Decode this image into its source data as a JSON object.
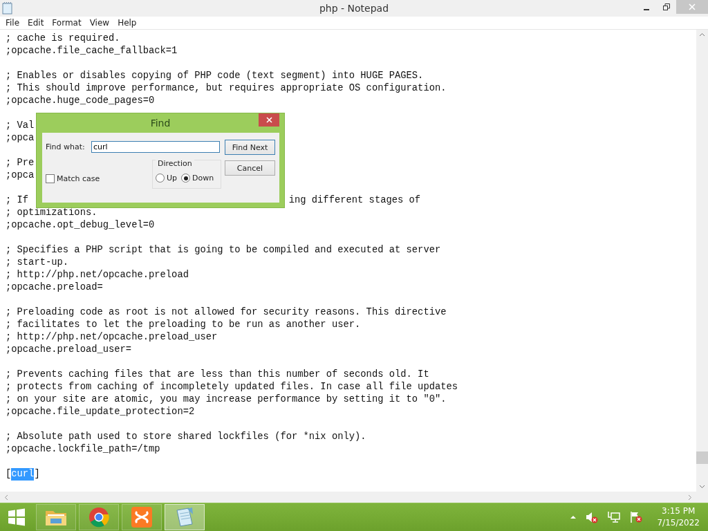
{
  "window": {
    "title": "php - Notepad"
  },
  "menu": [
    "File",
    "Edit",
    "Format",
    "View",
    "Help"
  ],
  "editor": {
    "paragraphs": [
      [
        {
          "text": "; cache is required."
        },
        {
          "text": ";opcache.file_cache_fallback=1"
        }
      ],
      [
        {
          "text": "; Enables or disables copying of PHP code (text segment) into HUGE PAGES."
        },
        {
          "text": "; This should improve performance, but requires appropriate OS configuration."
        },
        {
          "text": ";opcache.huge_code_pages=0"
        }
      ],
      [
        {
          "text": "; Val"
        },
        {
          "text": ";opca"
        }
      ],
      [
        {
          "text": "; Pre"
        },
        {
          "text": ";opca"
        }
      ],
      [
        {
          "text": "; If",
          "tail": "ing different stages of"
        },
        {
          "text": "; optimizations."
        },
        {
          "text": ";opcache.opt_debug_level=0"
        }
      ],
      [
        {
          "text": "; Specifies a PHP script that is going to be compiled and executed at server"
        },
        {
          "text": "; start-up."
        },
        {
          "text": "; http://php.net/opcache.preload"
        },
        {
          "text": ";opcache.preload="
        }
      ],
      [
        {
          "text": "; Preloading code as root is not allowed for security reasons. This directive"
        },
        {
          "text": "; facilitates to let the preloading to be run as another user."
        },
        {
          "text": "; http://php.net/opcache.preload_user"
        },
        {
          "text": ";opcache.preload_user="
        }
      ],
      [
        {
          "text": "; Prevents caching files that are less than this number of seconds old. It"
        },
        {
          "text": "; protects from caching of incompletely updated files. In case all file updates"
        },
        {
          "text": "; on your site are atomic, you may increase performance by setting it to \"0\"."
        },
        {
          "text": ";opcache.file_update_protection=2"
        }
      ],
      [
        {
          "text": "; Absolute path used to store shared lockfiles (for *nix only)."
        },
        {
          "text": ";opcache.lockfile_path=/tmp"
        }
      ],
      [
        {
          "segments": [
            {
              "text": "[",
              "selected": false
            },
            {
              "text": "curl",
              "selected": true
            },
            {
              "text": "]",
              "selected": false
            }
          ]
        }
      ]
    ]
  },
  "find_dialog": {
    "title": "Find",
    "find_what_label": "Find what:",
    "find_what": "curl",
    "buttons": [
      {
        "label": "Find Next",
        "focused": true
      },
      {
        "label": "Cancel",
        "focused": false
      }
    ],
    "direction": {
      "label": "Direction",
      "options": [
        {
          "label": "Up",
          "selected": false
        },
        {
          "label": "Down",
          "selected": true
        }
      ]
    },
    "match_case": {
      "label": "Match case",
      "checked": false
    }
  },
  "taskbar": {
    "apps": [
      {
        "kind": "folder",
        "active": false
      },
      {
        "kind": "browser",
        "active": false
      },
      {
        "kind": "xampp",
        "active": false
      },
      {
        "kind": "notepad",
        "active": true
      }
    ],
    "time": "3:15 PM",
    "date": "7/15/2022"
  }
}
